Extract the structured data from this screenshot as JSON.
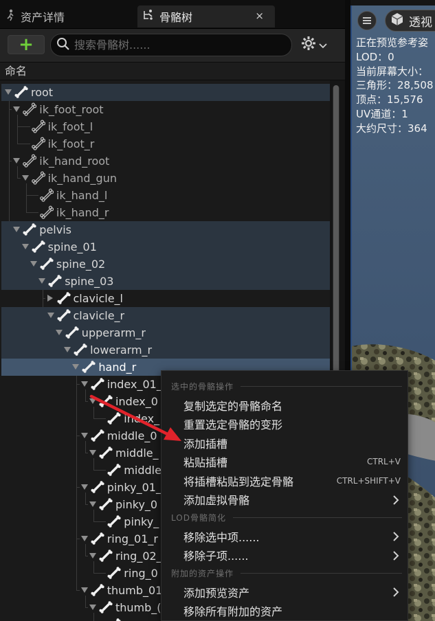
{
  "tabs": {
    "asset_details": "资产详情",
    "skeleton_tree": "骨骼树",
    "close": "×"
  },
  "toolbar": {
    "add_label": "+",
    "search_placeholder": "搜索骨骼树......"
  },
  "tree": {
    "column_header": "命名",
    "bones": [
      {
        "name": "root",
        "depth": 0,
        "expander": "open",
        "style": "hl"
      },
      {
        "name": "ik_foot_root",
        "depth": 1,
        "expander": "open",
        "style": "dim"
      },
      {
        "name": "ik_foot_l",
        "depth": 2,
        "expander": "none",
        "style": "dim"
      },
      {
        "name": "ik_foot_r",
        "depth": 2,
        "expander": "none",
        "style": "dim"
      },
      {
        "name": "ik_hand_root",
        "depth": 1,
        "expander": "open",
        "style": "dim"
      },
      {
        "name": "ik_hand_gun",
        "depth": 2,
        "expander": "open",
        "style": "dim"
      },
      {
        "name": "ik_hand_l",
        "depth": 3,
        "expander": "none",
        "style": "dim"
      },
      {
        "name": "ik_hand_r",
        "depth": 3,
        "expander": "none",
        "style": "dim"
      },
      {
        "name": "pelvis",
        "depth": 1,
        "expander": "open",
        "style": "hl"
      },
      {
        "name": "spine_01",
        "depth": 2,
        "expander": "open",
        "style": "hl"
      },
      {
        "name": "spine_02",
        "depth": 3,
        "expander": "open",
        "style": "hl"
      },
      {
        "name": "spine_03",
        "depth": 4,
        "expander": "open",
        "style": "hl"
      },
      {
        "name": "clavicle_l",
        "depth": 5,
        "expander": "closed",
        "style": "plain"
      },
      {
        "name": "clavicle_r",
        "depth": 5,
        "expander": "open",
        "style": "hl"
      },
      {
        "name": "upperarm_r",
        "depth": 6,
        "expander": "open",
        "style": "hl"
      },
      {
        "name": "lowerarm_r",
        "depth": 7,
        "expander": "open",
        "style": "hl"
      },
      {
        "name": "hand_r",
        "depth": 8,
        "expander": "open",
        "style": "sel"
      },
      {
        "name": "index_01_",
        "depth": 9,
        "expander": "open",
        "style": "plain"
      },
      {
        "name": "index_0",
        "depth": 10,
        "expander": "open",
        "style": "plain"
      },
      {
        "name": "index_",
        "depth": 11,
        "expander": "none",
        "style": "plain"
      },
      {
        "name": "middle_0",
        "depth": 9,
        "expander": "open",
        "style": "plain"
      },
      {
        "name": "middle_",
        "depth": 10,
        "expander": "open",
        "style": "plain"
      },
      {
        "name": "middle",
        "depth": 11,
        "expander": "none",
        "style": "plain"
      },
      {
        "name": "pinky_01_",
        "depth": 9,
        "expander": "open",
        "style": "plain"
      },
      {
        "name": "pinky_0",
        "depth": 10,
        "expander": "open",
        "style": "plain"
      },
      {
        "name": "pinky_",
        "depth": 11,
        "expander": "none",
        "style": "plain"
      },
      {
        "name": "ring_01_r",
        "depth": 9,
        "expander": "open",
        "style": "plain"
      },
      {
        "name": "ring_02_",
        "depth": 10,
        "expander": "open",
        "style": "plain"
      },
      {
        "name": "ring_0",
        "depth": 11,
        "expander": "none",
        "style": "plain"
      },
      {
        "name": "thumb_01",
        "depth": 9,
        "expander": "open",
        "style": "plain"
      },
      {
        "name": "thumb_(",
        "depth": 10,
        "expander": "open",
        "style": "plain"
      },
      {
        "name": "",
        "depth": 11,
        "expander": "none",
        "style": "plain"
      }
    ]
  },
  "viewport": {
    "perspective_label": "透视",
    "stats": [
      "正在预览参考姿",
      "LOD：0",
      "当前屏幕大小：",
      "三角形：28,508",
      "顶点：15,576",
      "UV通道：1",
      "大约尺寸：364"
    ]
  },
  "context_menu": {
    "sections": [
      {
        "title": "选中的骨骼操作",
        "items": [
          {
            "label": "复制选定的骨骼命名",
            "shortcut": "",
            "submenu": false
          },
          {
            "label": "重置选定骨骼的变形",
            "shortcut": "",
            "submenu": false
          },
          {
            "label": "添加插槽",
            "shortcut": "",
            "submenu": false
          },
          {
            "label": "粘贴插槽",
            "shortcut": "CTRL+V",
            "submenu": false
          },
          {
            "label": "将插槽粘贴到选定骨骼",
            "shortcut": "CTRL+SHIFT+V",
            "submenu": false
          },
          {
            "label": "添加虚拟骨骼",
            "shortcut": "",
            "submenu": true
          }
        ]
      },
      {
        "title": "LOD骨骼简化",
        "items": [
          {
            "label": "移除选中项......",
            "shortcut": "",
            "submenu": true
          },
          {
            "label": "移除子项......",
            "shortcut": "",
            "submenu": true
          }
        ]
      },
      {
        "title": "附加的资产操作",
        "items": [
          {
            "label": "添加预览资产",
            "shortcut": "",
            "submenu": true
          },
          {
            "label": "移除所有附加的资产",
            "shortcut": "",
            "submenu": false
          }
        ]
      }
    ]
  },
  "colors": {
    "panel_bg": "#1a1a1a",
    "row_highlight": "#2b3540",
    "row_selected": "#42566d",
    "add_icon_green": "#6fcf3a",
    "annotation_arrow": "#e0232b"
  }
}
